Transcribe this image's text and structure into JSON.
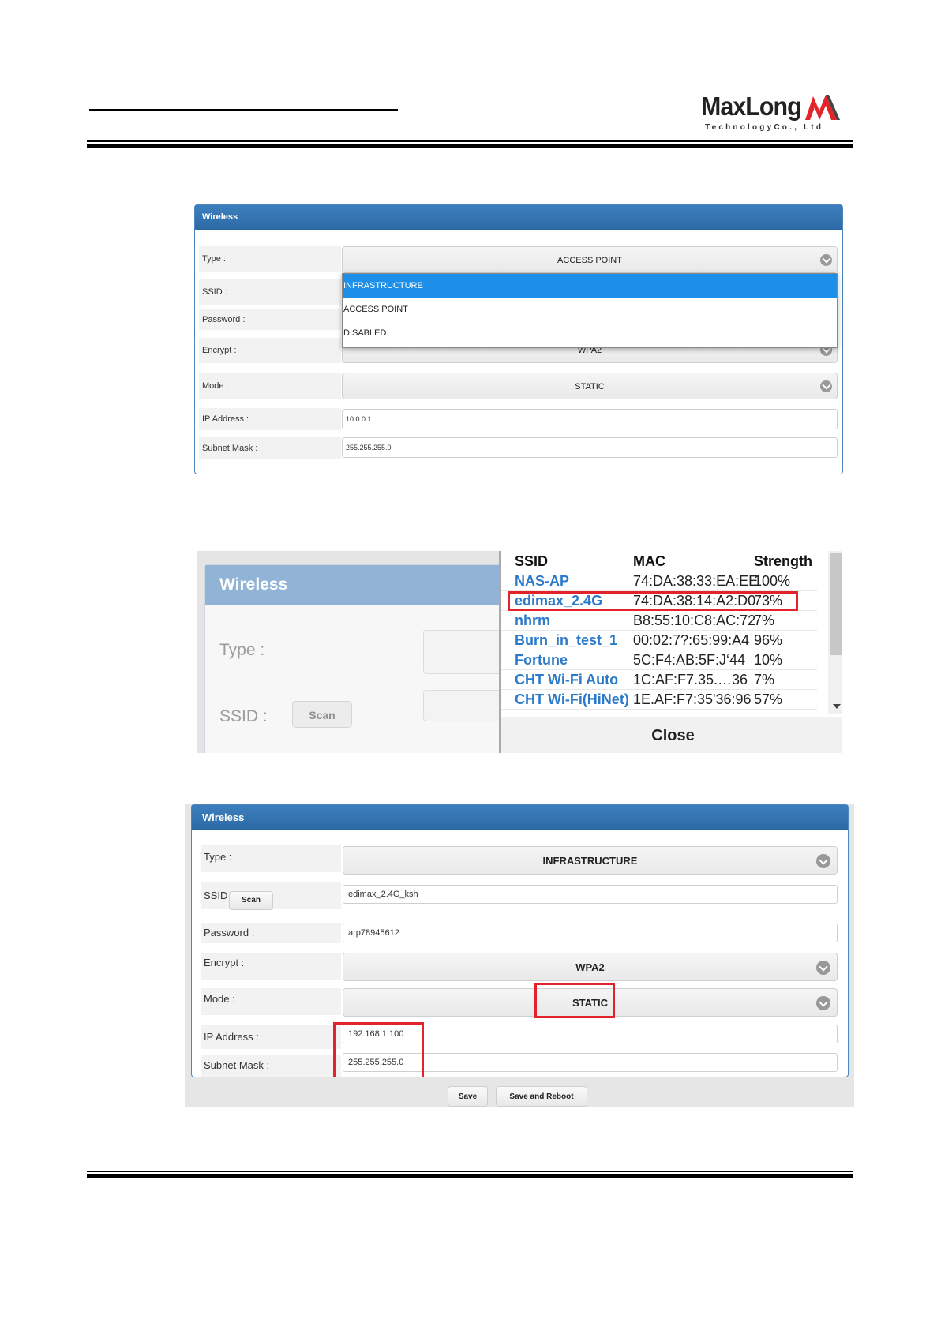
{
  "header": {
    "logo_text": "MaxLong",
    "logo_subtitle": "TechnologyCo., Ltd",
    "colors": {
      "logo_mark": "#e2232a",
      "rule": "#000000"
    }
  },
  "screenshot1": {
    "panel_title": "Wireless",
    "labels": [
      "Type :",
      "SSID :",
      "Password :",
      "Encrypt :",
      "Mode :",
      "IP Address :",
      "Subnet Mask :"
    ],
    "type_value": "ACCESS POINT",
    "dropdown_options": [
      "INFRASTRUCTURE",
      "ACCESS POINT",
      "DISABLED"
    ],
    "dropdown_highlighted": "INFRASTRUCTURE",
    "encrypt_value": "WPA2",
    "mode_value": "STATIC",
    "ip_address": "10.0.0.1",
    "subnet_mask": "255.255.255.0"
  },
  "screenshot2": {
    "panel_title": "Wireless",
    "type_label": "Type :",
    "ssid_label": "SSID :",
    "scan_button": "Scan",
    "table_headers": [
      "SSID",
      "MAC",
      "Strength"
    ],
    "networks": [
      {
        "ssid": "NAS-AP",
        "mac": "74:DA:38:33:EA:EE",
        "strength": "100%"
      },
      {
        "ssid": "edimax_2.4G",
        "mac": "74:DA:38:14:A2:D0",
        "strength": "73%"
      },
      {
        "ssid": "nhrm",
        "mac": "B8:55:10:C8:AC:72",
        "strength": "7%"
      },
      {
        "ssid": "Burn_in_test_1",
        "mac": "00:02:7?:65:99:A4",
        "strength": "96%"
      },
      {
        "ssid": "Fortune",
        "mac": "5C:F4:AB:5F:J‘44",
        "strength": "10%"
      },
      {
        "ssid": "CHT Wi-Fi Auto",
        "mac": "1C:AF:F7.35.…36",
        "strength": "7%"
      },
      {
        "ssid": "CHT Wi-Fi(HiNet)",
        "mac": "1E.AF:F7:35'36:96",
        "strength": "57%"
      }
    ],
    "close_button": "Close"
  },
  "screenshot3": {
    "panel_title": "Wireless",
    "type_label": "Type :",
    "type_value": "INFRASTRUCTURE",
    "ssid_label": "SSID :",
    "scan_button": "Scan",
    "ssid_value": "edimax_2.4G_ksh",
    "password_label": "Password :",
    "password_value": "arp78945612",
    "encrypt_label": "Encrypt :",
    "encrypt_value": "WPA2",
    "mode_label": "Mode :",
    "mode_value": "STATIC",
    "ip_label": "IP Address :",
    "ip_value": "192.168.1.100",
    "subnet_label": "Subnet Mask :",
    "subnet_value": "255.255.255.0",
    "save_button": "Save",
    "save_reboot_button": "Save and Reboot"
  }
}
